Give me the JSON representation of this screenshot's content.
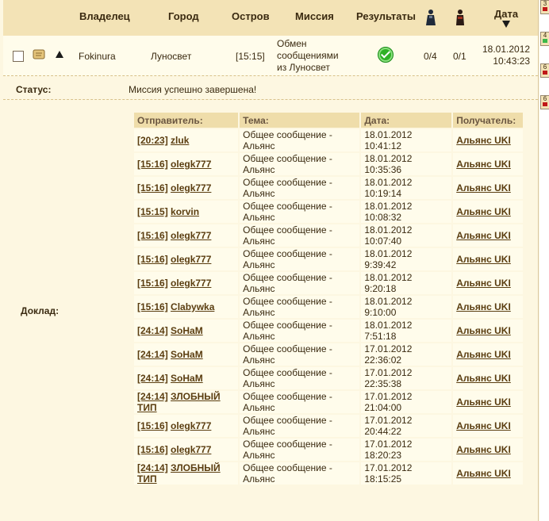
{
  "header": {
    "owner": "Владелец",
    "city": "Город",
    "island": "Остров",
    "mission": "Миссия",
    "results": "Результаты",
    "date": "Дата",
    "date_sort_icon": "triangle-down"
  },
  "mission_row": {
    "owner": "Fokinura",
    "city": "Луносвет",
    "island": "[15:15]",
    "mission_line1": "Обмен",
    "mission_line2": "сообщениями",
    "mission_line3": "из Луносвет",
    "troops_1": "0/4",
    "troops_2": "0/1",
    "date": "18.01.2012",
    "time": "10:43:23"
  },
  "status": {
    "label": "Статус:",
    "text": "Миссия успешно завершена!"
  },
  "report": {
    "label": "Доклад:",
    "columns": {
      "sender": "Отправитель:",
      "topic": "Тема:",
      "date": "Дата:",
      "recipient": "Получатель:"
    },
    "rows": [
      {
        "coords": "[20:23]",
        "sender": "zluk",
        "topic1": "Общее сообщение -",
        "topic2": "Альянс",
        "date": "18.01.2012",
        "time": "10:41:12",
        "recipient": "Альянс UKI"
      },
      {
        "coords": "[15:16]",
        "sender": "olegk777",
        "topic1": "Общее сообщение -",
        "topic2": "Альянс",
        "date": "18.01.2012",
        "time": "10:35:36",
        "recipient": "Альянс UKI"
      },
      {
        "coords": "[15:16]",
        "sender": "olegk777",
        "topic1": "Общее сообщение -",
        "topic2": "Альянс",
        "date": "18.01.2012",
        "time": "10:19:14",
        "recipient": "Альянс UKI"
      },
      {
        "coords": "[15:15]",
        "sender": "korvin",
        "topic1": "Общее сообщение -",
        "topic2": "Альянс",
        "date": "18.01.2012",
        "time": "10:08:32",
        "recipient": "Альянс UKI"
      },
      {
        "coords": "[15:16]",
        "sender": "olegk777",
        "topic1": "Общее сообщение -",
        "topic2": "Альянс",
        "date": "18.01.2012",
        "time": "10:07:40",
        "recipient": "Альянс UKI"
      },
      {
        "coords": "[15:16]",
        "sender": "olegk777",
        "topic1": "Общее сообщение -",
        "topic2": "Альянс",
        "date": "18.01.2012",
        "time": "9:39:42",
        "recipient": "Альянс UKI"
      },
      {
        "coords": "[15:16]",
        "sender": "olegk777",
        "topic1": "Общее сообщение -",
        "topic2": "Альянс",
        "date": "18.01.2012",
        "time": "9:20:18",
        "recipient": "Альянс UKI"
      },
      {
        "coords": "[15:16]",
        "sender": "Clabywka",
        "topic1": "Общее сообщение -",
        "topic2": "Альянс",
        "date": "18.01.2012",
        "time": "9:10:00",
        "recipient": "Альянс UKI"
      },
      {
        "coords": "[24:14]",
        "sender": "SoHaM",
        "topic1": "Общее сообщение -",
        "topic2": "Альянс",
        "date": "18.01.2012",
        "time": "7:51:18",
        "recipient": "Альянс UKI"
      },
      {
        "coords": "[24:14]",
        "sender": "SoHaM",
        "topic1": "Общее сообщение -",
        "topic2": "Альянс",
        "date": "17.01.2012",
        "time": "22:36:02",
        "recipient": "Альянс UKI"
      },
      {
        "coords": "[24:14]",
        "sender": "SoHaM",
        "topic1": "Общее сообщение -",
        "topic2": "Альянс",
        "date": "17.01.2012",
        "time": "22:35:38",
        "recipient": "Альянс UKI"
      },
      {
        "coords": "[24:14]",
        "sender": "ЗЛОБНЫЙ ТИП",
        "topic1": "Общее сообщение -",
        "topic2": "Альянс",
        "date": "17.01.2012",
        "time": "21:04:00",
        "recipient": "Альянс UKI"
      },
      {
        "coords": "[15:16]",
        "sender": "olegk777",
        "topic1": "Общее сообщение -",
        "topic2": "Альянс",
        "date": "17.01.2012",
        "time": "20:44:22",
        "recipient": "Альянс UKI"
      },
      {
        "coords": "[15:16]",
        "sender": "olegk777",
        "topic1": "Общее сообщение -",
        "topic2": "Альянс",
        "date": "17.01.2012",
        "time": "18:20:23",
        "recipient": "Альянс UKI"
      },
      {
        "coords": "[24:14]",
        "sender": "ЗЛОБНЫЙ ТИП",
        "topic1": "Общее сообщение -",
        "topic2": "Альянс",
        "date": "17.01.2012",
        "time": "18:15:25",
        "recipient": "Альянс UKI"
      }
    ]
  },
  "side_tabs": [
    {
      "label": "3",
      "color": "#C01818"
    },
    {
      "label": "4",
      "color": "#3DB84A"
    },
    {
      "label": "6",
      "color": "#C01818"
    },
    {
      "label": "6",
      "color": "#C01818"
    }
  ]
}
